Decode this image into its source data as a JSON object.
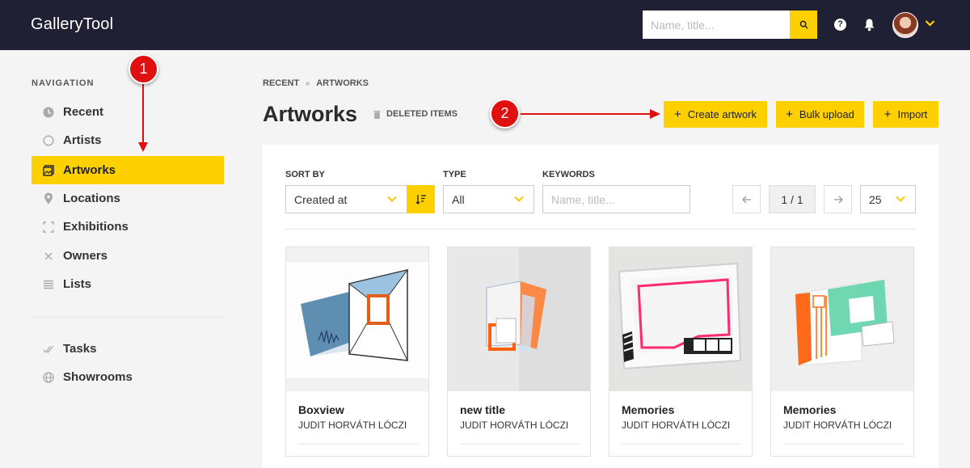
{
  "header": {
    "logo": "GalleryTool",
    "search_placeholder": "Name, title...",
    "help_label": "?"
  },
  "sidebar": {
    "title": "NAVIGATION",
    "items": [
      {
        "label": "Recent",
        "icon": "clock-icon"
      },
      {
        "label": "Artists",
        "icon": "circle-icon"
      },
      {
        "label": "Artworks",
        "icon": "image-icon",
        "active": true
      },
      {
        "label": "Locations",
        "icon": "map-pin-icon"
      },
      {
        "label": "Exhibitions",
        "icon": "frame-icon"
      },
      {
        "label": "Owners",
        "icon": "x-icon"
      },
      {
        "label": "Lists",
        "icon": "list-icon"
      }
    ],
    "secondary": [
      {
        "label": "Tasks",
        "icon": "double-check-icon"
      },
      {
        "label": "Showrooms",
        "icon": "globe-icon"
      }
    ]
  },
  "breadcrumb": [
    "RECENT",
    "ARTWORKS"
  ],
  "page": {
    "title": "Artworks",
    "deleted_label": "DELETED ITEMS"
  },
  "actions": {
    "create": "Create artwork",
    "bulk": "Bulk upload",
    "import": "Import",
    "plus": "+"
  },
  "filters": {
    "sort_label": "SORT BY",
    "sort_value": "Created at",
    "type_label": "TYPE",
    "type_value": "All",
    "keywords_label": "KEYWORDS",
    "keywords_placeholder": "Name, title...",
    "page_info": "1 / 1",
    "per_page": "25"
  },
  "artworks": [
    {
      "title": "Boxview",
      "artist": "JUDIT HORVÁTH LÓCZI"
    },
    {
      "title": "new title",
      "artist": "JUDIT HORVÁTH LÓCZI"
    },
    {
      "title": "Memories",
      "artist": "JUDIT HORVÁTH LÓCZI"
    },
    {
      "title": "Memories",
      "artist": "JUDIT HORVÁTH LÓCZI"
    }
  ],
  "annotations": {
    "badge1": "1",
    "badge2": "2"
  },
  "colors": {
    "accent": "#ffd000",
    "topbar": "#1f2033",
    "annotation": "#e01010"
  }
}
